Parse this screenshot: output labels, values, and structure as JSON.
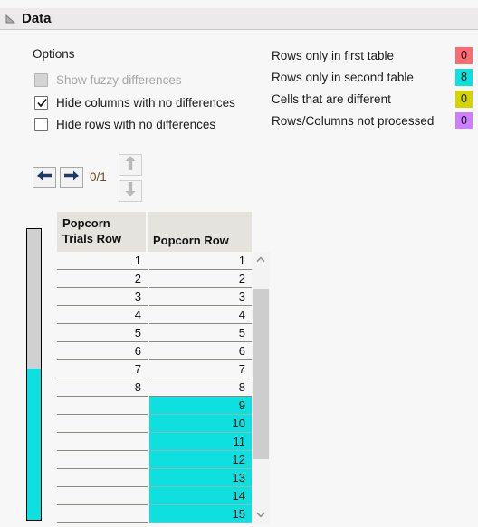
{
  "window": {
    "title": "Data",
    "disclosure_icon": "triangle-collapse-icon"
  },
  "options": {
    "heading": "Options",
    "checkboxes": [
      {
        "label": "Show fuzzy differences",
        "checked": false,
        "disabled": true
      },
      {
        "label": "Hide columns with no differences",
        "checked": true,
        "disabled": false
      },
      {
        "label": "Hide rows with no differences",
        "checked": false,
        "disabled": false
      }
    ]
  },
  "legend": {
    "rows": [
      {
        "label": "Rows only in first table",
        "count": "0",
        "color": "#ff6b75"
      },
      {
        "label": "Rows only in second table",
        "count": "8",
        "color": "#0ee0e0"
      },
      {
        "label": "Cells that are different",
        "count": "0",
        "color": "#d4d400"
      },
      {
        "label": "Rows/Columns not processed",
        "count": "0",
        "color": "#cc80ff"
      }
    ]
  },
  "navigation": {
    "prev_label": "previous-difference",
    "next_label": "next-difference",
    "counter": "0/1",
    "up_label": "scroll-up",
    "down_label": "scroll-down",
    "prev_enabled": true,
    "next_enabled": true,
    "up_enabled": false,
    "down_enabled": false,
    "arrow_color": "#1f3864",
    "disabled_arrow_color": "#b8b8b8"
  },
  "indicator_strip": {
    "top_color": "#d0d0d0",
    "bottom_color": "#0ee0e0",
    "bottom_fraction": 0.52
  },
  "table": {
    "columns": [
      "Popcorn Trials Row",
      "Popcorn Row"
    ],
    "rows": [
      {
        "c0": "1",
        "c1": "1",
        "highlight": false
      },
      {
        "c0": "2",
        "c1": "2",
        "highlight": false
      },
      {
        "c0": "3",
        "c1": "3",
        "highlight": false
      },
      {
        "c0": "4",
        "c1": "4",
        "highlight": false
      },
      {
        "c0": "5",
        "c1": "5",
        "highlight": false
      },
      {
        "c0": "6",
        "c1": "6",
        "highlight": false
      },
      {
        "c0": "7",
        "c1": "7",
        "highlight": false
      },
      {
        "c0": "8",
        "c1": "8",
        "highlight": false
      },
      {
        "c0": "",
        "c1": "9",
        "highlight": true
      },
      {
        "c0": "",
        "c1": "10",
        "highlight": true
      },
      {
        "c0": "",
        "c1": "11",
        "highlight": true
      },
      {
        "c0": "",
        "c1": "12",
        "highlight": true
      },
      {
        "c0": "",
        "c1": "13",
        "highlight": true
      },
      {
        "c0": "",
        "c1": "14",
        "highlight": true
      },
      {
        "c0": "",
        "c1": "15",
        "highlight": true
      }
    ],
    "highlight_color": "#0ee0e0",
    "scrollbar": {
      "up_icon": "chevron-up-icon",
      "down_icon": "chevron-down-icon",
      "thumb_top_pct": 8,
      "thumb_height_pct": 72
    }
  }
}
